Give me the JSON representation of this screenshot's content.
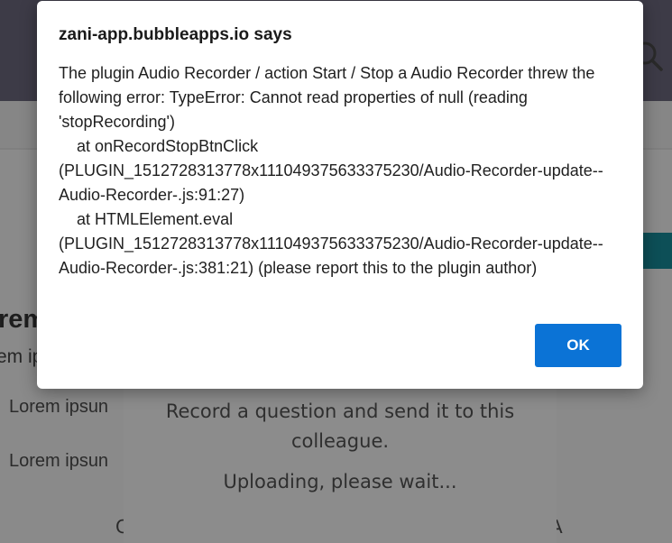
{
  "background": {
    "heading_fragment": "rem",
    "sub_fragment": "em ip",
    "list_items": [
      "Lorem ipsun",
      "Lorem ipsun"
    ],
    "bottom_left_fragment": "C",
    "bottom_right_fragment": "A",
    "recorder": {
      "prompt": "Record a question and send it to this colleague.",
      "status": "Uploading, please wait..."
    }
  },
  "dialog": {
    "title": "zani-app.bubbleapps.io says",
    "message": "The plugin Audio Recorder / action Start / Stop a Audio Recorder threw the following error: TypeError: Cannot read properties of null (reading 'stopRecording')\n    at onRecordStopBtnClick (PLUGIN_1512728313778x111049375633375230/Audio-Recorder-update--Audio-Recorder-.js:91:27)\n    at HTMLElement.eval (PLUGIN_1512728313778x111049375633375230/Audio-Recorder-update--Audio-Recorder-.js:381:21) (please report this to the plugin author)",
    "ok_label": "OK"
  },
  "colors": {
    "ok_button": "#0b73d6",
    "header_bg": "#3d3b47",
    "accent_teal": "#0d4f57"
  },
  "icons": {
    "header_search": "search-icon"
  }
}
